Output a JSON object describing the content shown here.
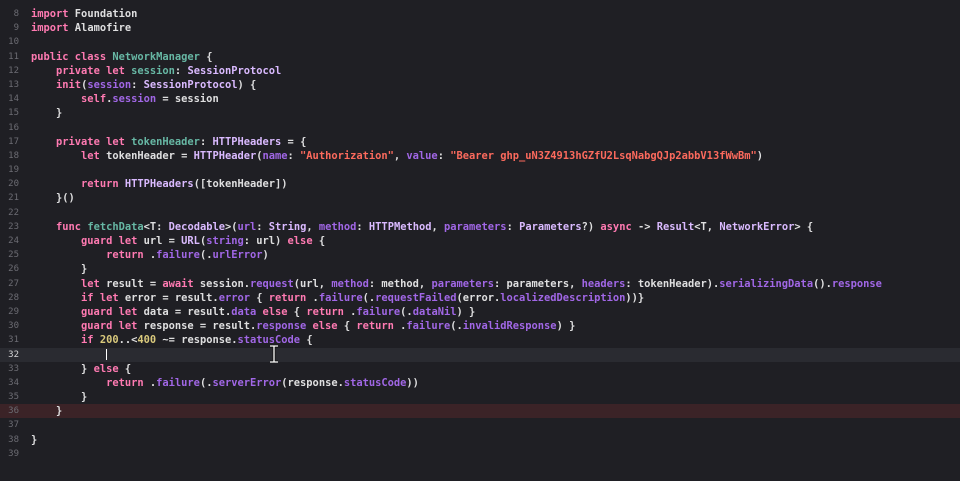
{
  "editor": {
    "current_line": 32,
    "error_line": 36,
    "colors": {
      "background": "#1f1f24",
      "keyword": "#ff7ab2",
      "type": "#dabaff",
      "function": "#67b7a4",
      "property": "#a167e6",
      "string": "#fc6a5d",
      "number": "#d9c97c",
      "plain": "#dfdfe0"
    },
    "lines": [
      {
        "n": "8",
        "tokens": [
          {
            "t": "kw",
            "v": "import"
          },
          {
            "t": "pl",
            "v": " Foundation"
          }
        ]
      },
      {
        "n": "9",
        "tokens": [
          {
            "t": "kw",
            "v": "import"
          },
          {
            "t": "pl",
            "v": " Alamofire"
          }
        ]
      },
      {
        "n": "10",
        "tokens": []
      },
      {
        "n": "11",
        "tokens": [
          {
            "t": "kw",
            "v": "public class"
          },
          {
            "t": "pl",
            "v": " "
          },
          {
            "t": "fn",
            "v": "NetworkManager"
          },
          {
            "t": "pl",
            "v": " {"
          }
        ]
      },
      {
        "n": "12",
        "tokens": [
          {
            "t": "pl",
            "v": "    "
          },
          {
            "t": "kw",
            "v": "private let"
          },
          {
            "t": "pl",
            "v": " "
          },
          {
            "t": "fn",
            "v": "session"
          },
          {
            "t": "pl",
            "v": ": "
          },
          {
            "t": "ty",
            "v": "SessionProtocol"
          }
        ]
      },
      {
        "n": "13",
        "tokens": [
          {
            "t": "pl",
            "v": "    "
          },
          {
            "t": "kw",
            "v": "init"
          },
          {
            "t": "pl",
            "v": "("
          },
          {
            "t": "pr",
            "v": "session"
          },
          {
            "t": "pl",
            "v": ": "
          },
          {
            "t": "ty",
            "v": "SessionProtocol"
          },
          {
            "t": "pl",
            "v": ") {"
          }
        ]
      },
      {
        "n": "14",
        "tokens": [
          {
            "t": "pl",
            "v": "        "
          },
          {
            "t": "kw",
            "v": "self"
          },
          {
            "t": "pl",
            "v": "."
          },
          {
            "t": "pr",
            "v": "session"
          },
          {
            "t": "pl",
            "v": " = session"
          }
        ]
      },
      {
        "n": "15",
        "tokens": [
          {
            "t": "pl",
            "v": "    }"
          }
        ]
      },
      {
        "n": "16",
        "tokens": []
      },
      {
        "n": "17",
        "tokens": [
          {
            "t": "pl",
            "v": "    "
          },
          {
            "t": "kw",
            "v": "private let"
          },
          {
            "t": "pl",
            "v": " "
          },
          {
            "t": "fn",
            "v": "tokenHeader"
          },
          {
            "t": "pl",
            "v": ": "
          },
          {
            "t": "ty",
            "v": "HTTPHeaders"
          },
          {
            "t": "pl",
            "v": " = {"
          }
        ]
      },
      {
        "n": "18",
        "tokens": [
          {
            "t": "pl",
            "v": "        "
          },
          {
            "t": "kw",
            "v": "let"
          },
          {
            "t": "pl",
            "v": " tokenHeader = "
          },
          {
            "t": "ty",
            "v": "HTTPHeader"
          },
          {
            "t": "pl",
            "v": "("
          },
          {
            "t": "pr",
            "v": "name"
          },
          {
            "t": "pl",
            "v": ": "
          },
          {
            "t": "st",
            "v": "\"Authorization\""
          },
          {
            "t": "pl",
            "v": ", "
          },
          {
            "t": "pr",
            "v": "value"
          },
          {
            "t": "pl",
            "v": ": "
          },
          {
            "t": "st",
            "v": "\"Bearer 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\""
          },
          {
            "t": "pl",
            "v": ")"
          }
        ]
      },
      {
        "n": "19",
        "tokens": []
      },
      {
        "n": "20",
        "tokens": [
          {
            "t": "pl",
            "v": "        "
          },
          {
            "t": "kw",
            "v": "return"
          },
          {
            "t": "pl",
            "v": " "
          },
          {
            "t": "ty",
            "v": "HTTPHeaders"
          },
          {
            "t": "pl",
            "v": "([tokenHeader])"
          }
        ]
      },
      {
        "n": "21",
        "tokens": [
          {
            "t": "pl",
            "v": "    }()"
          }
        ]
      },
      {
        "n": "22",
        "tokens": []
      },
      {
        "n": "23",
        "tokens": [
          {
            "t": "pl",
            "v": "    "
          },
          {
            "t": "kw",
            "v": "func"
          },
          {
            "t": "pl",
            "v": " "
          },
          {
            "t": "fn",
            "v": "fetchData"
          },
          {
            "t": "pl",
            "v": "<T: "
          },
          {
            "t": "ty",
            "v": "Decodable"
          },
          {
            "t": "pl",
            "v": ">("
          },
          {
            "t": "pr",
            "v": "url"
          },
          {
            "t": "pl",
            "v": ": "
          },
          {
            "t": "ty",
            "v": "String"
          },
          {
            "t": "pl",
            "v": ", "
          },
          {
            "t": "pr",
            "v": "method"
          },
          {
            "t": "pl",
            "v": ": "
          },
          {
            "t": "ty",
            "v": "HTTPMethod"
          },
          {
            "t": "pl",
            "v": ", "
          },
          {
            "t": "pr",
            "v": "parameters"
          },
          {
            "t": "pl",
            "v": ": "
          },
          {
            "t": "ty",
            "v": "Parameters"
          },
          {
            "t": "pl",
            "v": "?) "
          },
          {
            "t": "kw",
            "v": "async"
          },
          {
            "t": "pl",
            "v": " -> "
          },
          {
            "t": "ty",
            "v": "Result"
          },
          {
            "t": "pl",
            "v": "<T, "
          },
          {
            "t": "ty",
            "v": "NetworkError"
          },
          {
            "t": "pl",
            "v": "> {"
          }
        ]
      },
      {
        "n": "24",
        "tokens": [
          {
            "t": "pl",
            "v": "        "
          },
          {
            "t": "kw",
            "v": "guard let"
          },
          {
            "t": "pl",
            "v": " url = "
          },
          {
            "t": "ty",
            "v": "URL"
          },
          {
            "t": "pl",
            "v": "("
          },
          {
            "t": "pr",
            "v": "string"
          },
          {
            "t": "pl",
            "v": ": url) "
          },
          {
            "t": "kw",
            "v": "else"
          },
          {
            "t": "pl",
            "v": " {"
          }
        ]
      },
      {
        "n": "25",
        "tokens": [
          {
            "t": "pl",
            "v": "            "
          },
          {
            "t": "kw",
            "v": "return"
          },
          {
            "t": "pl",
            "v": " ."
          },
          {
            "t": "pr",
            "v": "failure"
          },
          {
            "t": "pl",
            "v": "(."
          },
          {
            "t": "pr",
            "v": "urlError"
          },
          {
            "t": "pl",
            "v": ")"
          }
        ]
      },
      {
        "n": "26",
        "tokens": [
          {
            "t": "pl",
            "v": "        }"
          }
        ]
      },
      {
        "n": "27",
        "tokens": [
          {
            "t": "pl",
            "v": "        "
          },
          {
            "t": "kw",
            "v": "let"
          },
          {
            "t": "pl",
            "v": " result = "
          },
          {
            "t": "kw",
            "v": "await"
          },
          {
            "t": "pl",
            "v": " session."
          },
          {
            "t": "pr",
            "v": "request"
          },
          {
            "t": "pl",
            "v": "(url, "
          },
          {
            "t": "pr",
            "v": "method"
          },
          {
            "t": "pl",
            "v": ": method, "
          },
          {
            "t": "pr",
            "v": "parameters"
          },
          {
            "t": "pl",
            "v": ": parameters, "
          },
          {
            "t": "pr",
            "v": "headers"
          },
          {
            "t": "pl",
            "v": ": tokenHeader)."
          },
          {
            "t": "pr",
            "v": "serializingData"
          },
          {
            "t": "pl",
            "v": "()."
          },
          {
            "t": "pr",
            "v": "response"
          }
        ]
      },
      {
        "n": "28",
        "tokens": [
          {
            "t": "pl",
            "v": "        "
          },
          {
            "t": "kw",
            "v": "if let"
          },
          {
            "t": "pl",
            "v": " error = result."
          },
          {
            "t": "pr",
            "v": "error"
          },
          {
            "t": "pl",
            "v": " { "
          },
          {
            "t": "kw",
            "v": "return"
          },
          {
            "t": "pl",
            "v": " ."
          },
          {
            "t": "pr",
            "v": "failure"
          },
          {
            "t": "pl",
            "v": "(."
          },
          {
            "t": "pr",
            "v": "requestFailed"
          },
          {
            "t": "pl",
            "v": "(error."
          },
          {
            "t": "pr",
            "v": "localizedDescription"
          },
          {
            "t": "pl",
            "v": "))}"
          }
        ]
      },
      {
        "n": "29",
        "tokens": [
          {
            "t": "pl",
            "v": "        "
          },
          {
            "t": "kw",
            "v": "guard let"
          },
          {
            "t": "pl",
            "v": " data = result."
          },
          {
            "t": "pr",
            "v": "data"
          },
          {
            "t": "pl",
            "v": " "
          },
          {
            "t": "kw",
            "v": "else"
          },
          {
            "t": "pl",
            "v": " { "
          },
          {
            "t": "kw",
            "v": "return"
          },
          {
            "t": "pl",
            "v": " ."
          },
          {
            "t": "pr",
            "v": "failure"
          },
          {
            "t": "pl",
            "v": "(."
          },
          {
            "t": "pr",
            "v": "dataNil"
          },
          {
            "t": "pl",
            "v": ") }"
          }
        ]
      },
      {
        "n": "30",
        "tokens": [
          {
            "t": "pl",
            "v": "        "
          },
          {
            "t": "kw",
            "v": "guard let"
          },
          {
            "t": "pl",
            "v": " response = result."
          },
          {
            "t": "pr",
            "v": "response"
          },
          {
            "t": "pl",
            "v": " "
          },
          {
            "t": "kw",
            "v": "else"
          },
          {
            "t": "pl",
            "v": " { "
          },
          {
            "t": "kw",
            "v": "return"
          },
          {
            "t": "pl",
            "v": " ."
          },
          {
            "t": "pr",
            "v": "failure"
          },
          {
            "t": "pl",
            "v": "(."
          },
          {
            "t": "pr",
            "v": "invalidResponse"
          },
          {
            "t": "pl",
            "v": ") }"
          }
        ]
      },
      {
        "n": "31",
        "tokens": [
          {
            "t": "pl",
            "v": "        "
          },
          {
            "t": "kw",
            "v": "if"
          },
          {
            "t": "pl",
            "v": " "
          },
          {
            "t": "nm",
            "v": "200"
          },
          {
            "t": "pl",
            "v": "..<"
          },
          {
            "t": "nm",
            "v": "400"
          },
          {
            "t": "pl",
            "v": " ~= response."
          },
          {
            "t": "pr",
            "v": "statusCode"
          },
          {
            "t": "pl",
            "v": " {"
          }
        ]
      },
      {
        "n": "32",
        "tokens": [
          {
            "t": "pl",
            "v": "            "
          }
        ],
        "caret": true
      },
      {
        "n": "33",
        "tokens": [
          {
            "t": "pl",
            "v": "        } "
          },
          {
            "t": "kw",
            "v": "else"
          },
          {
            "t": "pl",
            "v": " {"
          }
        ]
      },
      {
        "n": "34",
        "tokens": [
          {
            "t": "pl",
            "v": "            "
          },
          {
            "t": "kw",
            "v": "return"
          },
          {
            "t": "pl",
            "v": " ."
          },
          {
            "t": "pr",
            "v": "failure"
          },
          {
            "t": "pl",
            "v": "(."
          },
          {
            "t": "pr",
            "v": "serverError"
          },
          {
            "t": "pl",
            "v": "(response."
          },
          {
            "t": "pr",
            "v": "statusCode"
          },
          {
            "t": "pl",
            "v": "))"
          }
        ]
      },
      {
        "n": "35",
        "tokens": [
          {
            "t": "pl",
            "v": "        }"
          }
        ]
      },
      {
        "n": "36",
        "tokens": [
          {
            "t": "pl",
            "v": "    }"
          }
        ]
      },
      {
        "n": "37",
        "tokens": []
      },
      {
        "n": "38",
        "tokens": [
          {
            "t": "pl",
            "v": "}"
          }
        ]
      },
      {
        "n": "39",
        "tokens": []
      }
    ]
  }
}
